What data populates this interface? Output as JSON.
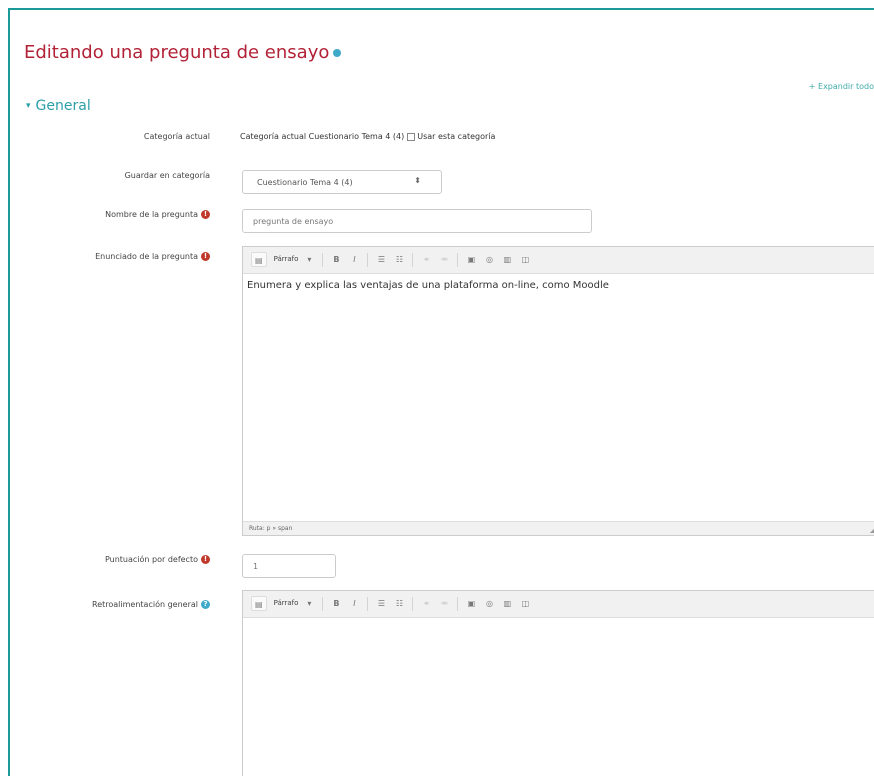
{
  "page": {
    "title": "Editando una pregunta de ensayo",
    "expand_all": "+ Expandir todo",
    "section_general": "General"
  },
  "fields": {
    "current_category": {
      "label": "Categoría actual",
      "text": "Categoría actual Cuestionario Tema 4 (4)",
      "checkbox_label": "Usar esta categoría",
      "checked": false
    },
    "save_in_category": {
      "label": "Guardar en categoría",
      "value": "Cuestionario Tema 4 (4)"
    },
    "question_name": {
      "label": "Nombre de la pregunta",
      "value": "pregunta de ensayo"
    },
    "question_text": {
      "label": "Enunciado de la pregunta",
      "content": "Enumera y explica las ventajas de una plataforma on-line, como Moodle",
      "path": "Ruta: p » span"
    },
    "default_mark": {
      "label": "Puntuación por defecto",
      "value": "1"
    },
    "general_feedback": {
      "label": "Retroalimentación general",
      "content": ""
    }
  },
  "editor_toolbar": {
    "paragraph": "Párrafo",
    "icons": [
      "toggle-icon",
      "paragraph-dropdown",
      "bold-icon",
      "italic-icon",
      "bullet-list-icon",
      "numbered-list-icon",
      "link-icon",
      "unlink-icon",
      "image-icon",
      "media-icon",
      "manage-files-icon",
      "more-icon"
    ]
  },
  "colors": {
    "title": "#b22236",
    "accent": "#2b9fa8",
    "required": "#c0392b",
    "help": "#3fa9c9"
  }
}
